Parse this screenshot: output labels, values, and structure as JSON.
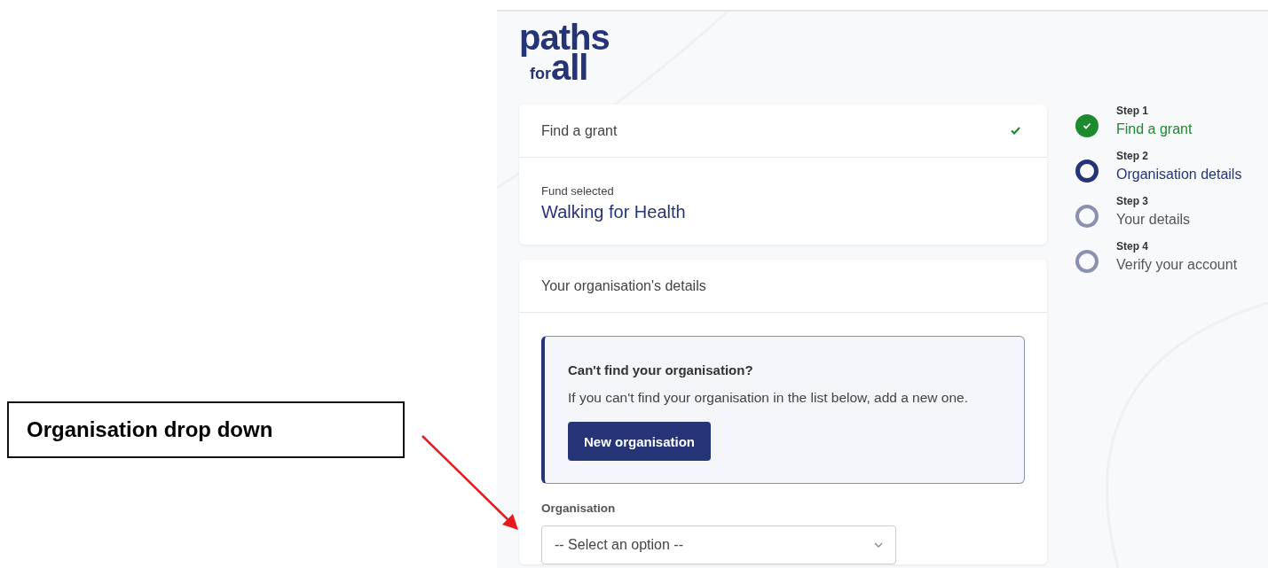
{
  "annotation": {
    "label": "Organisation drop down"
  },
  "logo": {
    "top": "paths",
    "small": "for",
    "bottom": "all"
  },
  "grant_card": {
    "title": "Find a grant",
    "complete": true,
    "fund_label": "Fund selected",
    "fund_name": "Walking for Health"
  },
  "organisation_card": {
    "title": "Your organisation's details",
    "info": {
      "heading": "Can't find your organisation?",
      "text": "If you can't find your organisation in the list below, add a new one.",
      "button": "New organisation"
    },
    "field": {
      "label": "Organisation",
      "placeholder": "-- Select an option --"
    }
  },
  "steps": [
    {
      "step": "Step 1",
      "label": "Find a grant",
      "kind": "complete"
    },
    {
      "step": "Step 2",
      "label": "Organisation details",
      "kind": "current"
    },
    {
      "step": "Step 3",
      "label": "Your details",
      "kind": "upcoming"
    },
    {
      "step": "Step 4",
      "label": "Verify your account",
      "kind": "upcoming"
    }
  ]
}
